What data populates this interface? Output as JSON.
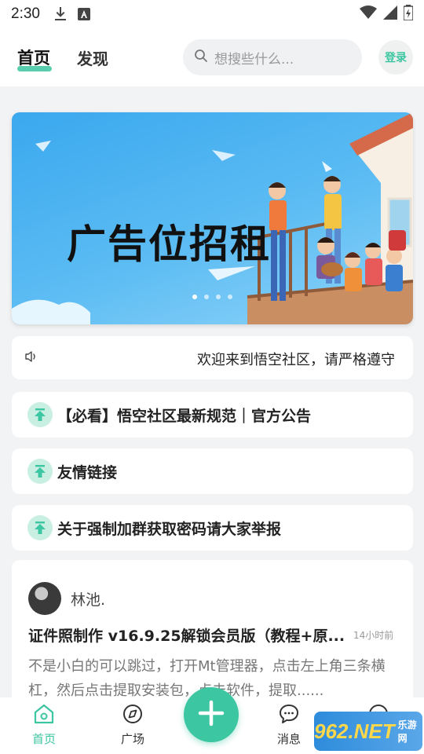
{
  "status_bar": {
    "time": "2:30"
  },
  "header": {
    "tabs": [
      {
        "label": "首页",
        "active": true
      },
      {
        "label": "发现",
        "active": false
      }
    ],
    "search_placeholder": "想搜些什么...",
    "login_label": "登录"
  },
  "banner": {
    "text": "广告位招租",
    "dots_count": 4,
    "active_dot": 1
  },
  "notice": {
    "text": "欢迎来到悟空社区，请严格遵守"
  },
  "pinned": [
    {
      "title": "【必看】悟空社区最新规范｜官方公告"
    },
    {
      "title": "友情链接"
    },
    {
      "title": "关于强制加群获取密码请大家举报"
    }
  ],
  "post": {
    "author": "林池.",
    "title": "证件照制作 v16.9.25解锁会员版（教程+原...",
    "time": "14小时前",
    "body": "不是小白的可以跳过，打开Mt管理器，点击左上角三条横杠，然后点击提取安装包，点击软件，提取......"
  },
  "bottom_nav": [
    {
      "label": "首页",
      "icon": "home-icon",
      "active": true
    },
    {
      "label": "广场",
      "icon": "compass-icon",
      "active": false
    },
    {
      "label": "消息",
      "icon": "chat-icon",
      "active": false
    },
    {
      "label": "",
      "icon": "profile-icon",
      "active": false
    }
  ],
  "watermark": {
    "main": "962.NET",
    "sub": "乐游网"
  },
  "colors": {
    "accent": "#3cc6a1",
    "banner_blue": "#3aa8ee"
  }
}
